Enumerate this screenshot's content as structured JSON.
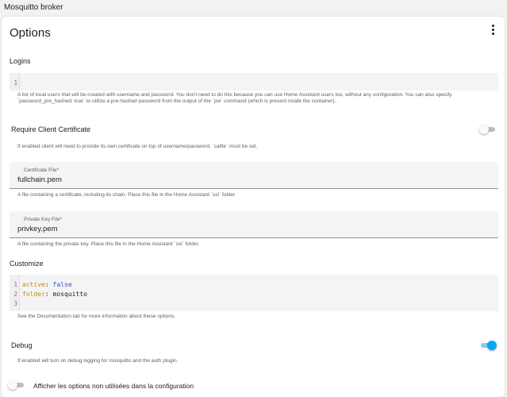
{
  "window": {
    "title": "Mosquitto broker"
  },
  "card": {
    "title": "Options"
  },
  "logins": {
    "label": "Logins",
    "lines": [
      "1"
    ],
    "helper": "A list of local users that will be created with username and password. You don't need to do this because you can use Home Assistant users too, without any configuration. You can also specify `password_pre_hashed: true` to utilize a pre-hashed password from the output of the `pw` command (which is present inside the container)."
  },
  "require_cert": {
    "label": "Require Client Certificate",
    "state": "off",
    "helper": "If enabled client will need to provide its own certificate on top of username/password. `cafile` must be set."
  },
  "certfile": {
    "label": "Certificate File*",
    "value": "fullchain.pem",
    "helper": "A file containing a certificate, including its chain. Place this file in the Home Assistant `ssl` folder."
  },
  "keyfile": {
    "label": "Private Key File*",
    "value": "privkey.pem",
    "helper": "A file containing the private key. Place this file in the Home Assistant `ssl` folder."
  },
  "customize": {
    "label": "Customize",
    "line_numbers": [
      "1",
      "2",
      "3"
    ],
    "line1_key": "active",
    "line1_sep": ": ",
    "line1_val": "false",
    "line2_key": "folder",
    "line2_sep": ": ",
    "line2_val": "mosquitto",
    "helper": "See the Documentation tab for more information about these options."
  },
  "debug": {
    "label": "Debug",
    "state": "on",
    "helper": "If enabled will turn on debug logging for mosquitto and the auth plugin."
  },
  "show_unused": {
    "label": "Afficher les options non utilisées dans la configuration",
    "state": "off"
  },
  "colors": {
    "accent": "#03a9f4",
    "key": "#c7880b",
    "value": "#3f51b5"
  },
  "icons": {
    "menu": "more-vert-icon"
  }
}
